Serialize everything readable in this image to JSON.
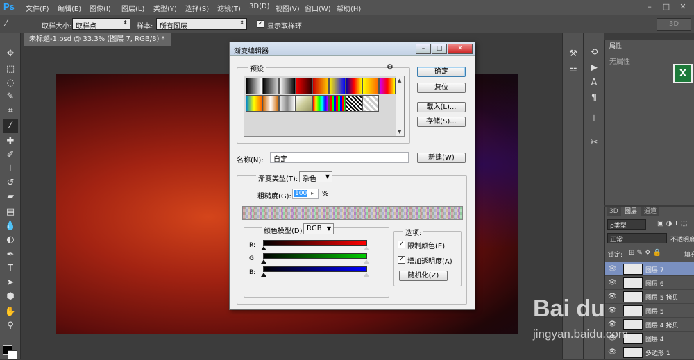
{
  "app": {
    "logo": "Ps"
  },
  "menu": [
    "文件(F)",
    "编辑(E)",
    "图像(I)",
    "图层(L)",
    "类型(Y)",
    "选择(S)",
    "滤镜(T)",
    "3D(D)",
    "视图(V)",
    "窗口(W)",
    "帮助(H)"
  ],
  "window_buttons": [
    "–",
    "□",
    "✕"
  ],
  "options": {
    "sample_size_label": "取样大小:",
    "sample_size_value": "取样点",
    "sample_label": "样本:",
    "sample_value": "所有图层",
    "show_ring_label": "显示取样环",
    "show_ring_checked": true,
    "workspace": "3D"
  },
  "document": {
    "tab": "未标题-1.psd @ 33.3% (图层 7, RGB/8) *"
  },
  "properties": {
    "tab": "属性",
    "empty_text": "无属性"
  },
  "layers": {
    "tabs": [
      "3D",
      "图层",
      "通道"
    ],
    "filter_label": "ρ类型",
    "blend_mode": "正常",
    "opacity_label": "不透明度",
    "lock_label": "锁定:",
    "fill_label": "填充",
    "items": [
      {
        "name": "图层 7",
        "selected": true
      },
      {
        "name": "图层 6",
        "selected": false
      },
      {
        "name": "图层 5 拷贝",
        "selected": false
      },
      {
        "name": "图层 5",
        "selected": false
      },
      {
        "name": "图层 4 拷贝",
        "selected": false
      },
      {
        "name": "图层 4",
        "selected": false
      },
      {
        "name": "多边形 1",
        "selected": false
      }
    ]
  },
  "dialog": {
    "title": "渐变编辑器",
    "presets_label": "预设",
    "ok": "确定",
    "reset": "复位",
    "load": "载入(L)...",
    "save": "存储(S)...",
    "name_label": "名称(N):",
    "name_value": "自定",
    "new_button": "新建(W)",
    "gradient_type_label": "渐变类型(T):",
    "gradient_type_value": "杂色",
    "roughness_label": "粗糙度(G):",
    "roughness_value": "100",
    "roughness_unit": "%",
    "color_model_label": "颜色模型(D)",
    "color_model_value": "RGB",
    "channels": [
      "R:",
      "G:",
      "B:"
    ],
    "options_label": "选项:",
    "restrict_colors": "限制颜色(E)",
    "restrict_checked": true,
    "add_transparency": "增加透明度(A)",
    "transparency_checked": true,
    "randomize": "随机化(Z)",
    "preset_swatches": [
      "linear-gradient(90deg,#000,#fff)",
      "linear-gradient(90deg,#000,rgba(0,0,0,0))",
      "linear-gradient(90deg,#fff,#000)",
      "linear-gradient(90deg,#e00,#300)",
      "linear-gradient(90deg,#c00,#fc0)",
      "linear-gradient(90deg,#fe0,#00f)",
      "linear-gradient(90deg,#00a,#f00,#ff0)",
      "linear-gradient(90deg,#ff0,#f60)",
      "linear-gradient(90deg,#c0f,#f00,#ff0)",
      "linear-gradient(90deg,#08c,#ff0,#f60)",
      "linear-gradient(90deg,#c60,#fff,#c60)",
      "linear-gradient(90deg,#eee,#888,#fff)",
      "linear-gradient(135deg,#fff,#cc9,#996)",
      "linear-gradient(90deg,#f00,#ff0,#0f0,#0ff,#00f,#f0f)",
      "repeating-linear-gradient(90deg,#f00 0 3px,#0f0 3px 6px,#00f 6px 9px)",
      "repeating-linear-gradient(45deg,#000 0 2px,#fff 2px 4px)",
      "repeating-linear-gradient(45deg,#ccc 0 3px,#fff 3px 6px)"
    ],
    "channel_gradients": [
      "linear-gradient(90deg,#000,#f00)",
      "linear-gradient(90deg,#000,#0c0)",
      "linear-gradient(90deg,#000,#00f)"
    ]
  },
  "watermark": {
    "logo": "Bai du",
    "url": "jingyan.baidu.com"
  }
}
